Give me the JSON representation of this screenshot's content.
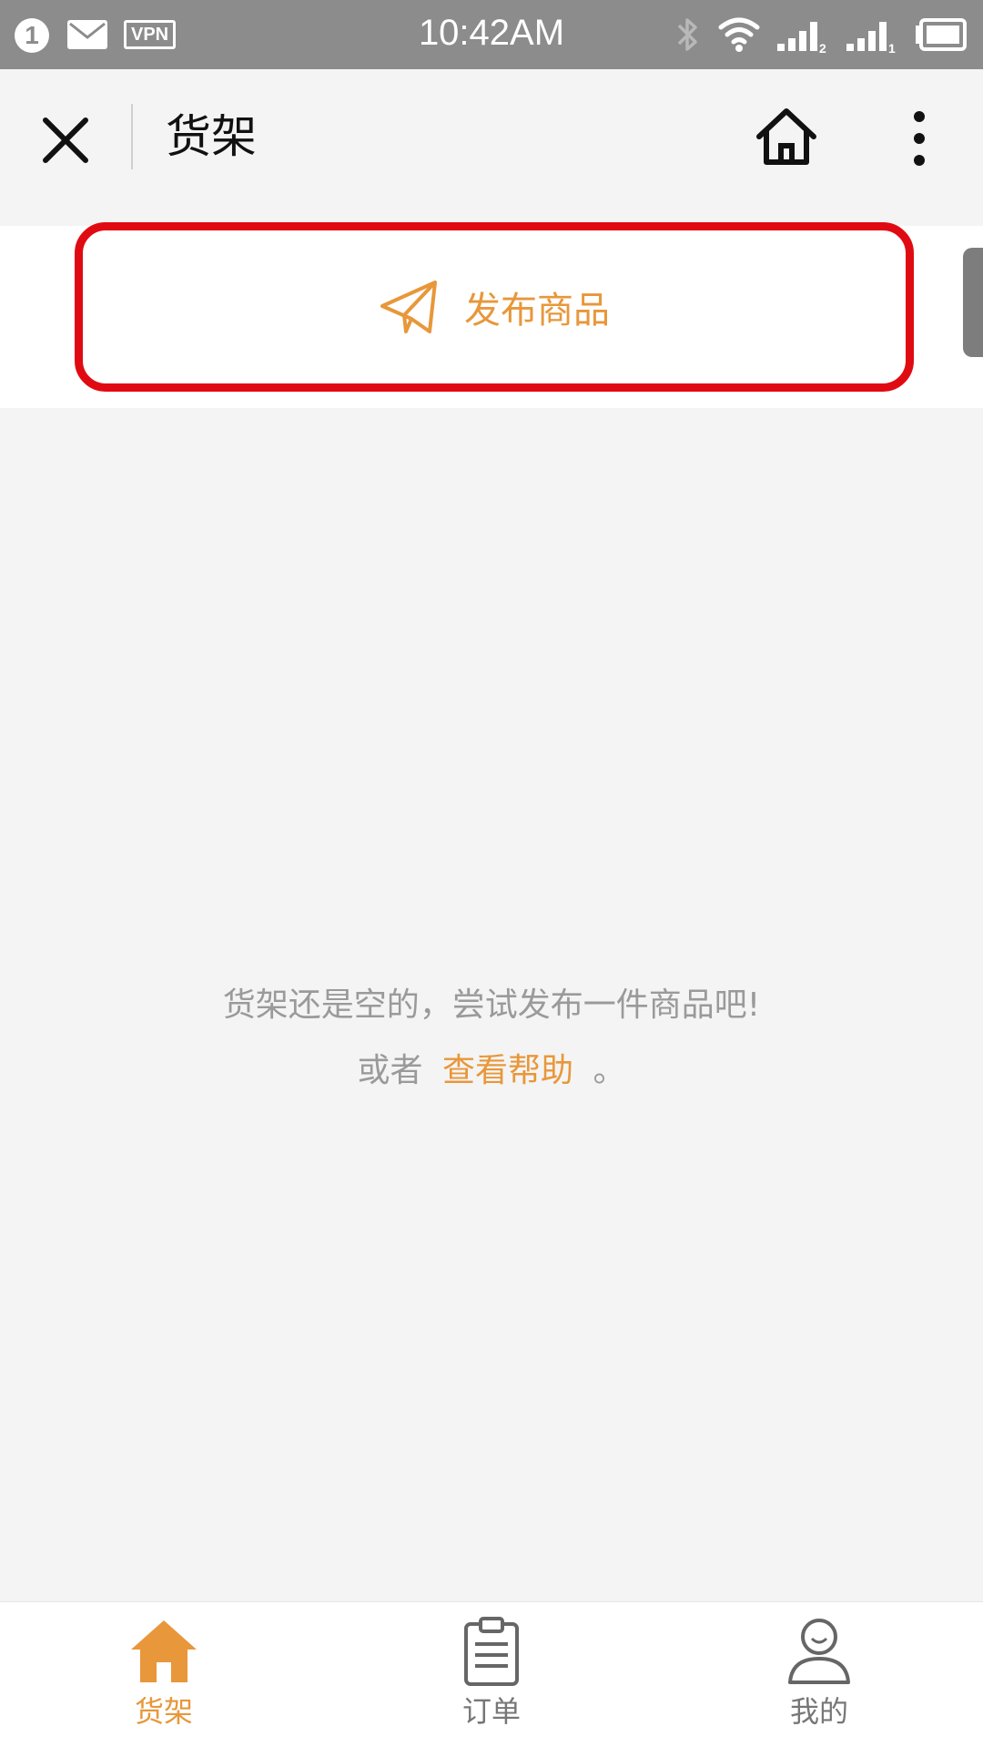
{
  "status_bar": {
    "notification_count": "1",
    "vpn_label": "VPN",
    "time": "10:42AM",
    "icons": [
      "notification-badge-icon",
      "mail-icon",
      "vpn-icon",
      "bluetooth-icon",
      "wifi-icon",
      "signal-sim2-icon",
      "signal-sim1-icon",
      "battery-icon"
    ]
  },
  "nav": {
    "title": "货架",
    "icons": [
      "close-icon",
      "home-icon",
      "more-vertical-icon"
    ]
  },
  "publish": {
    "label": "发布商品",
    "icon": "paper-plane-icon"
  },
  "empty_state": {
    "message": "货架还是空的，尝试发布一件商品吧!",
    "help_prefix": "或者",
    "help_link": "查看帮助",
    "help_suffix": "。"
  },
  "tabs": [
    {
      "label": "货架",
      "icon": "home-filled-icon",
      "active": true
    },
    {
      "label": "订单",
      "icon": "clipboard-icon",
      "active": false
    },
    {
      "label": "我的",
      "icon": "user-icon",
      "active": false
    }
  ],
  "colors": {
    "accent": "#e8973a",
    "highlight_border": "#e00b12",
    "status_bar": "#8c8c8c",
    "background": "#f4f4f4",
    "muted_text": "#9a9a9a"
  }
}
